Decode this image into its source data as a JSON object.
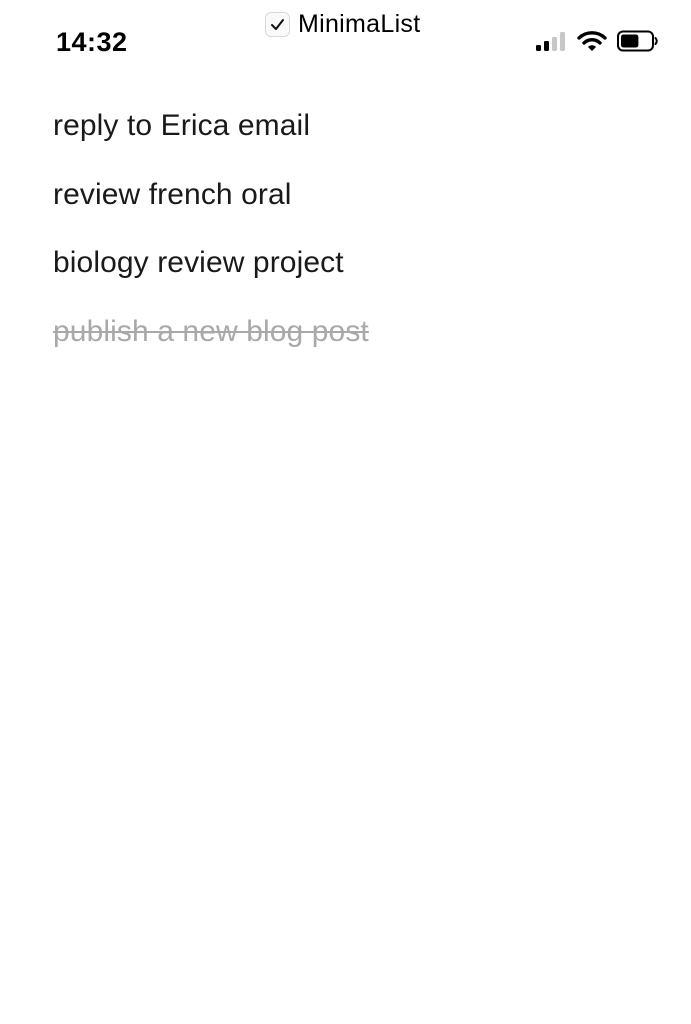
{
  "status_bar": {
    "time": "14:32",
    "app_name": "MinimaList",
    "signal_bars_active": 2,
    "signal_bars_total": 4,
    "battery_level": 0.6
  },
  "tasks": [
    {
      "text": "reply to Erica email",
      "done": false
    },
    {
      "text": "review french oral",
      "done": false
    },
    {
      "text": "biology review project",
      "done": false
    },
    {
      "text": "publish a new blog post",
      "done": true
    }
  ],
  "colors": {
    "text": "#1a1a1a",
    "done_text": "#a9a9a9",
    "background": "#ffffff"
  }
}
